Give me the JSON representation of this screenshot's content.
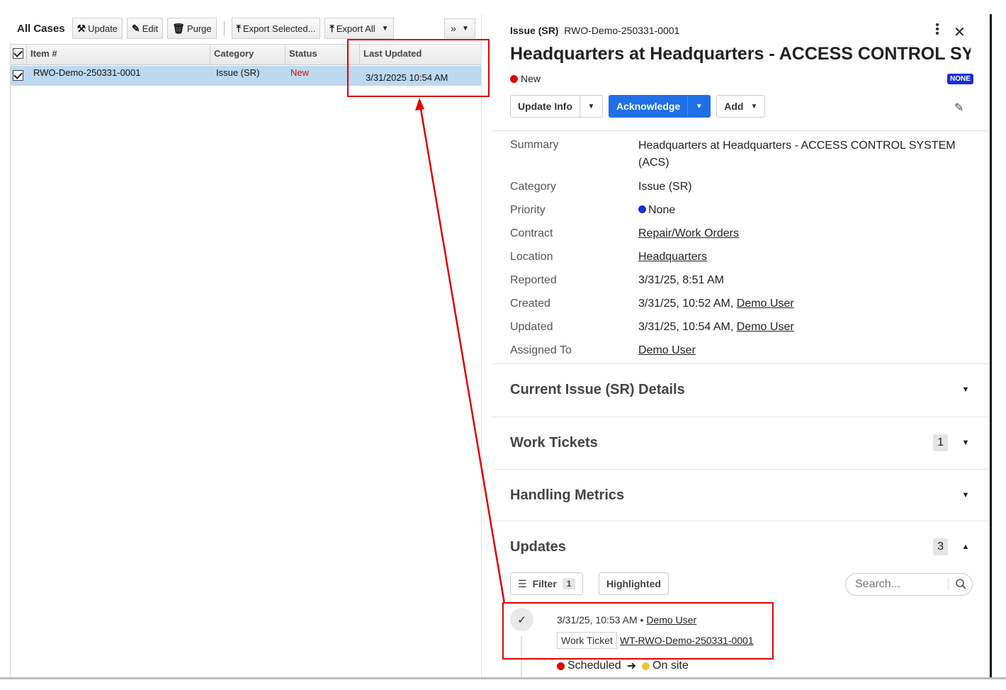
{
  "grid": {
    "title": "All Cases",
    "toolbar": {
      "update": "Update",
      "edit": "Edit",
      "purge": "Purge",
      "export_selected": "Export Selected...",
      "export_all": "Export All"
    },
    "columns": [
      "Item #",
      "Category",
      "Status",
      "Last Updated"
    ],
    "rows": [
      {
        "item": "RWO-Demo-250331-0001",
        "category": "Issue (SR)",
        "status": "New",
        "last_updated": "3/31/2025 10:54 AM"
      }
    ]
  },
  "detail": {
    "type_label": "Issue (SR)",
    "id": "RWO-Demo-250331-0001",
    "title": "Headquarters at Headquarters - ACCESS CONTROL SY…",
    "status": "New",
    "priority_badge": "NONE",
    "actions": {
      "update_info": "Update Info",
      "acknowledge": "Acknowledge",
      "add": "Add"
    },
    "fields": [
      {
        "label": "Summary",
        "value": "Headquarters at Headquarters - ACCESS CONTROL SYSTEM (ACS)"
      },
      {
        "label": "Category",
        "value": "Issue (SR)"
      },
      {
        "label": "Priority",
        "value": "None"
      },
      {
        "label": "Contract",
        "value": "Repair/Work Orders"
      },
      {
        "label": "Location",
        "value": "Headquarters"
      },
      {
        "label": "Reported",
        "value": "3/31/25, 8:51 AM"
      },
      {
        "label": "Created",
        "value": "3/31/25, 10:52 AM, ",
        "user": "Demo User"
      },
      {
        "label": "Updated",
        "value": "3/31/25, 10:54 AM, ",
        "user": "Demo User"
      },
      {
        "label": "Assigned To",
        "value": "Demo User"
      }
    ],
    "sections": [
      {
        "title": "Current Issue (SR) Details",
        "count": ""
      },
      {
        "title": "Work Tickets",
        "count": "1"
      },
      {
        "title": "Handling Metrics",
        "count": ""
      },
      {
        "title": "Updates",
        "count": "3"
      }
    ],
    "updates": {
      "filter_label": "Filter",
      "filter_count": "1",
      "highlighted_label": "Highlighted",
      "search_placeholder": "Search...",
      "entry": {
        "timestamp": "3/31/25, 10:53 AM",
        "separator": "•",
        "user": "Demo User",
        "tag": "Work Ticket",
        "ticket": "WT-RWO-Demo-250331-0001",
        "from_status": "Scheduled",
        "to_status": "On site"
      }
    }
  },
  "colors": {
    "status_new": "#e00000",
    "priority_none": "#1a2fd6",
    "acknowledge": "#1f6fe8",
    "scheduled": "#e00000",
    "on_site": "#e6c832",
    "annotation": "#e00000",
    "selected_row": "#bcd9f0"
  },
  "icons": [
    "update-tools-icon",
    "edit-icon",
    "trash-icon",
    "export-icon",
    "more-chevrons-icon",
    "kebab-icon",
    "close-icon",
    "pencil-icon",
    "filter-icon",
    "search-icon",
    "check-icon",
    "arrow-right-icon"
  ]
}
